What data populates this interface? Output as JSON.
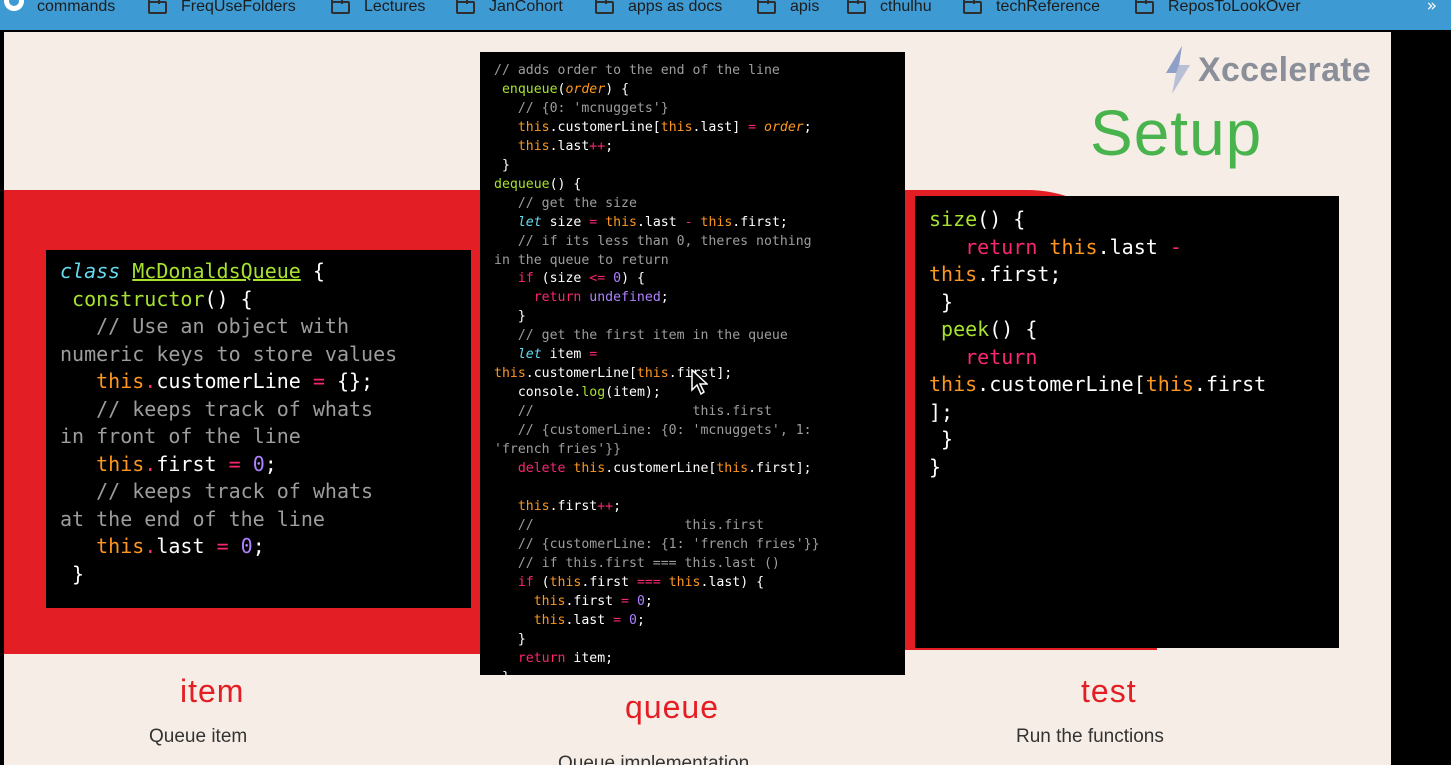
{
  "bookmarks": {
    "items": [
      {
        "label": "commands",
        "icon": "github-icon"
      },
      {
        "label": "FreqUseFolders",
        "icon": "folder-icon"
      },
      {
        "label": "Lectures",
        "icon": "folder-icon"
      },
      {
        "label": "JanCohort",
        "icon": "folder-icon"
      },
      {
        "label": "apps as docs",
        "icon": "folder-icon"
      },
      {
        "label": "apis",
        "icon": "folder-icon"
      },
      {
        "label": "cthulhu",
        "icon": "folder-icon"
      },
      {
        "label": "techReference",
        "icon": "folder-icon"
      },
      {
        "label": "ReposToLookOver",
        "icon": "folder-icon"
      }
    ],
    "more": "»"
  },
  "slide": {
    "logo_text": "Xccelerate",
    "title": "Setup",
    "colors": {
      "band": "#e31e24",
      "title": "#49b34d",
      "background": "#f6eee6"
    },
    "sections": [
      {
        "title": "item",
        "subtitle": "Queue item"
      },
      {
        "title": "queue",
        "subtitle": "Queue implementation"
      },
      {
        "title": "test",
        "subtitle": "Run the functions"
      }
    ]
  },
  "code": {
    "left": [
      "class McDonaldsQueue {",
      " constructor() {",
      "   // Use an object with",
      "numeric keys to store values",
      "   this.customerLine = {};",
      "   // keeps track of whats",
      "in front of the line",
      "   this.first = 0;",
      "   // keeps track of whats",
      "at the end of the line",
      "   this.last = 0;",
      " }"
    ],
    "middle": [
      "// adds order to the end of the line",
      " enqueue(order) {",
      "   // {0: 'mcnuggets'}",
      "   this.customerLine[this.last] = order;",
      "   this.last++;",
      " }",
      "dequeue() {",
      "   // get the size",
      "   let size = this.last - this.first;",
      "   // if its less than 0, theres nothing",
      "in the queue to return",
      "   if (size <= 0) {",
      "     return undefined;",
      "   }",
      "   // get the first item in the queue",
      "   let item =",
      "this.customerLine[this.first];",
      "   console.log(item);",
      "   //                    this.first",
      "   // {customerLine: {0: 'mcnuggets', 1:",
      "'french fries'}}",
      "   delete this.customerLine[this.first];",
      "",
      "   this.first++;",
      "   //                   this.first",
      "   // {customerLine: {1: 'french fries'}}",
      "   // if this.first === this.last ()",
      "   if (this.first === this.last) {",
      "     this.first = 0;",
      "     this.last = 0;",
      "   }",
      "   return item;",
      " }"
    ],
    "right": [
      "size() {",
      "   return this.last -",
      "this.first;",
      " }",
      " peek() {",
      "   return",
      "this.customerLine[this.first",
      "];",
      " }",
      "}"
    ]
  }
}
